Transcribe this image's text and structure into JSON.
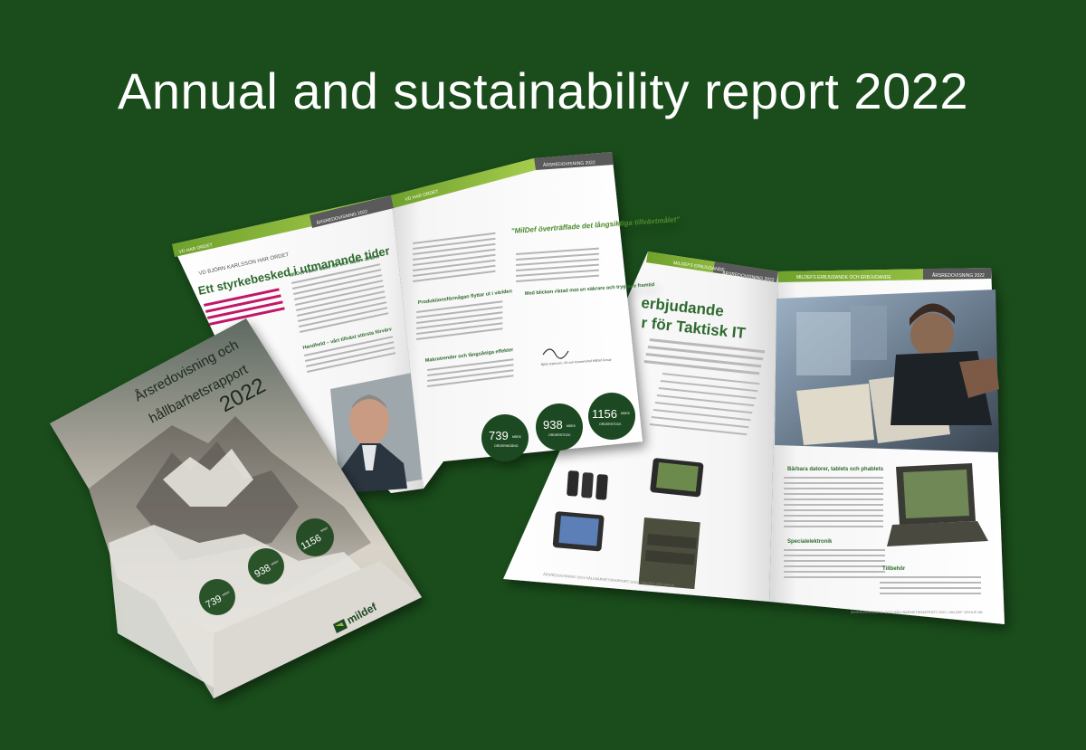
{
  "banner": {
    "title": "Annual and sustainability report 2022"
  },
  "colors": {
    "background": "#1a4d1b",
    "accent_green": "#8dbb3c",
    "dark_green": "#1f4a22",
    "header_gray": "#5a5a5a",
    "magenta": "#c2186b"
  },
  "spread_one": {
    "left_page": {
      "section_tab": "VD HAR ORDET",
      "kicker": "VD BJÖRN KARLSSON HAR ORDET",
      "headline": "Ett styrkebesked i utmanande tider",
      "subheading_1": "MilDef växer både för och bättre affärer",
      "subheading_2": "Handheld – vårt tillväxt största förvärv"
    },
    "right_page": {
      "section_tab": "VD HAR ORDET",
      "report_tab": "ÅRSREDOVISNING 2022",
      "quote": "\"MilDef överträffade det långsiktiga tillväxtmålet\"",
      "subheading_1": "Produktionsförmågan flyttar ut i världen",
      "subheading_2": "Med blicken riktad mot en säkrare och tryggare framtid",
      "subheading_3": "Makrotrender och långsiktiga effekter",
      "signature_caption": "Björn Karlsson, VD och koncernchef MilDef Group",
      "kpis": [
        {
          "value": "739",
          "unit": "MSEK",
          "label": "ORDERINGÅNG"
        },
        {
          "value": "938",
          "unit": "MSEK",
          "label": "ORDERSTOCK"
        },
        {
          "value": "1156",
          "unit": "MSEK",
          "label": "ORDERSTOCK"
        }
      ]
    }
  },
  "spread_two": {
    "left_page": {
      "section_tab": "MILDEFS ERBJUDANDE",
      "report_tab": "ÅRSREDOVISNING 2022",
      "headline_line_1": "erbjudande",
      "headline_line_2": "r för Taktisk IT",
      "footer": "ÅRSREDOVISNING OCH HÅLLBARHETSRAPPORT 2022 • MILDEF GROUP AB"
    },
    "right_page": {
      "section_tab": "MILDEFS ERBJUDANDE OCH ERBJUDANDE",
      "report_tab": "ÅRSREDOVISNING 2022",
      "subheading_1": "Bärbara datorer, tablets och phablets",
      "subheading_2": "Specialelektronik",
      "subheading_3": "Tillbehör",
      "footer": "ÅRSREDOVISNING OCH HÅLLBARHETSRAPPORT 2022 • MILDEF GROUP AB"
    }
  },
  "cover": {
    "title_line_1": "Årsredovisning och",
    "title_line_2": "hållbarhetsrapport",
    "year": "2022",
    "brand": "mildef",
    "kpis": [
      {
        "value": "739",
        "unit": "MSEK"
      },
      {
        "value": "938",
        "unit": "MSEK"
      },
      {
        "value": "1156",
        "unit": "MSEK"
      }
    ]
  }
}
